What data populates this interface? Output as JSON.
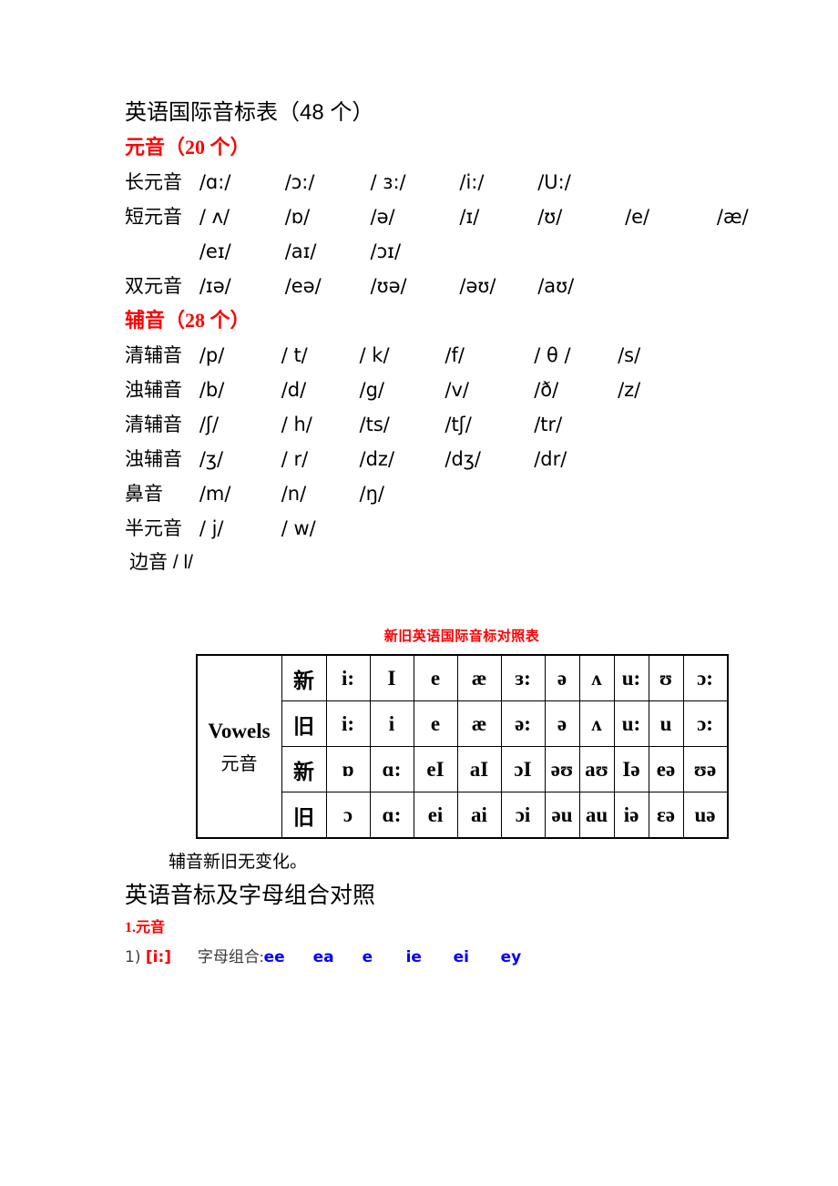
{
  "document": {
    "title": "英语国际音标表（48 个）",
    "vowels_heading": "元音（20 个）",
    "consonants_heading": "辅音（28 个）",
    "phoneme_rows": [
      {
        "label": "长元音",
        "symbols": [
          "/ɑ:/",
          "/ɔ:/",
          "/ ɜ:/",
          "/i:/",
          "/U:/"
        ]
      },
      {
        "label": "短元音",
        "symbols": [
          "/ ʌ/",
          "/ɒ/",
          "/ə/",
          "/ɪ/",
          "/ʊ/",
          "/e/",
          "/æ/"
        ]
      },
      {
        "label": "",
        "symbols": [
          "/eɪ/",
          "/aɪ/",
          "/ɔɪ/"
        ]
      },
      {
        "label": "双元音",
        "symbols": [
          "/ɪə/",
          "/eə/",
          "/ʊə/",
          "/əʊ/",
          "/aʊ/"
        ]
      }
    ],
    "consonant_rows": [
      {
        "label": "清辅音",
        "symbols": [
          "/p/",
          "/ t/",
          "/ k/",
          "/f/",
          "/ θ /",
          "/s/"
        ]
      },
      {
        "label": "浊辅音",
        "symbols": [
          "/b/",
          "/d/",
          "/g/",
          "/v/",
          "/ð/",
          "/z/"
        ]
      },
      {
        "label": "清辅音",
        "symbols": [
          "/ʃ/",
          "/ h/",
          "/ts/",
          "/tʃ/",
          "/tr/"
        ]
      },
      {
        "label": "浊辅音",
        "symbols": [
          "/ʒ/",
          "/ r/",
          "/dz/",
          "/dʒ/",
          "/dr/"
        ]
      },
      {
        "label": "鼻音",
        "symbols": [
          "/m/",
          "/n/",
          "/ŋ/"
        ]
      },
      {
        "label": "半元音",
        "symbols": [
          "/ j/",
          "/ w/"
        ]
      },
      {
        "label": "边音 / l/",
        "symbols": []
      }
    ]
  },
  "comparison_table": {
    "caption": "新旧英语国际音标对照表",
    "row_label_en": "Vowels",
    "row_label_cn": "元音",
    "new_label": "新",
    "old_label": "旧",
    "rows": [
      {
        "kind": "新",
        "cells": [
          "i:",
          "I",
          "e",
          "æ",
          "ɜ:",
          "ə",
          "ʌ",
          "u:",
          "ʊ",
          "ɔ:"
        ]
      },
      {
        "kind": "旧",
        "cells": [
          "i:",
          "i",
          "e",
          "æ",
          "ə:",
          "ə",
          "ʌ",
          "u:",
          "u",
          "ɔ:"
        ]
      },
      {
        "kind": "新",
        "cells": [
          "ɒ",
          "ɑ:",
          "eI",
          "aI",
          "ɔI",
          "əʊ",
          "aʊ",
          "Iə",
          "eə",
          "ʊə"
        ]
      },
      {
        "kind": "旧",
        "cells": [
          "ɔ",
          "ɑ:",
          "ei",
          "ai",
          "ɔi",
          "əu",
          "au",
          "iə",
          "ɛə",
          "uə"
        ]
      }
    ]
  },
  "footer": {
    "note": "辅音新旧无变化。",
    "section_title": "英语音标及字母组合对照",
    "subsection": "1.元音",
    "entry": {
      "index": "1)",
      "ipa": "[i:]",
      "label": "字母组合:",
      "combos": [
        "ee",
        "ea",
        "e",
        "ie",
        "ei",
        "ey"
      ]
    }
  }
}
